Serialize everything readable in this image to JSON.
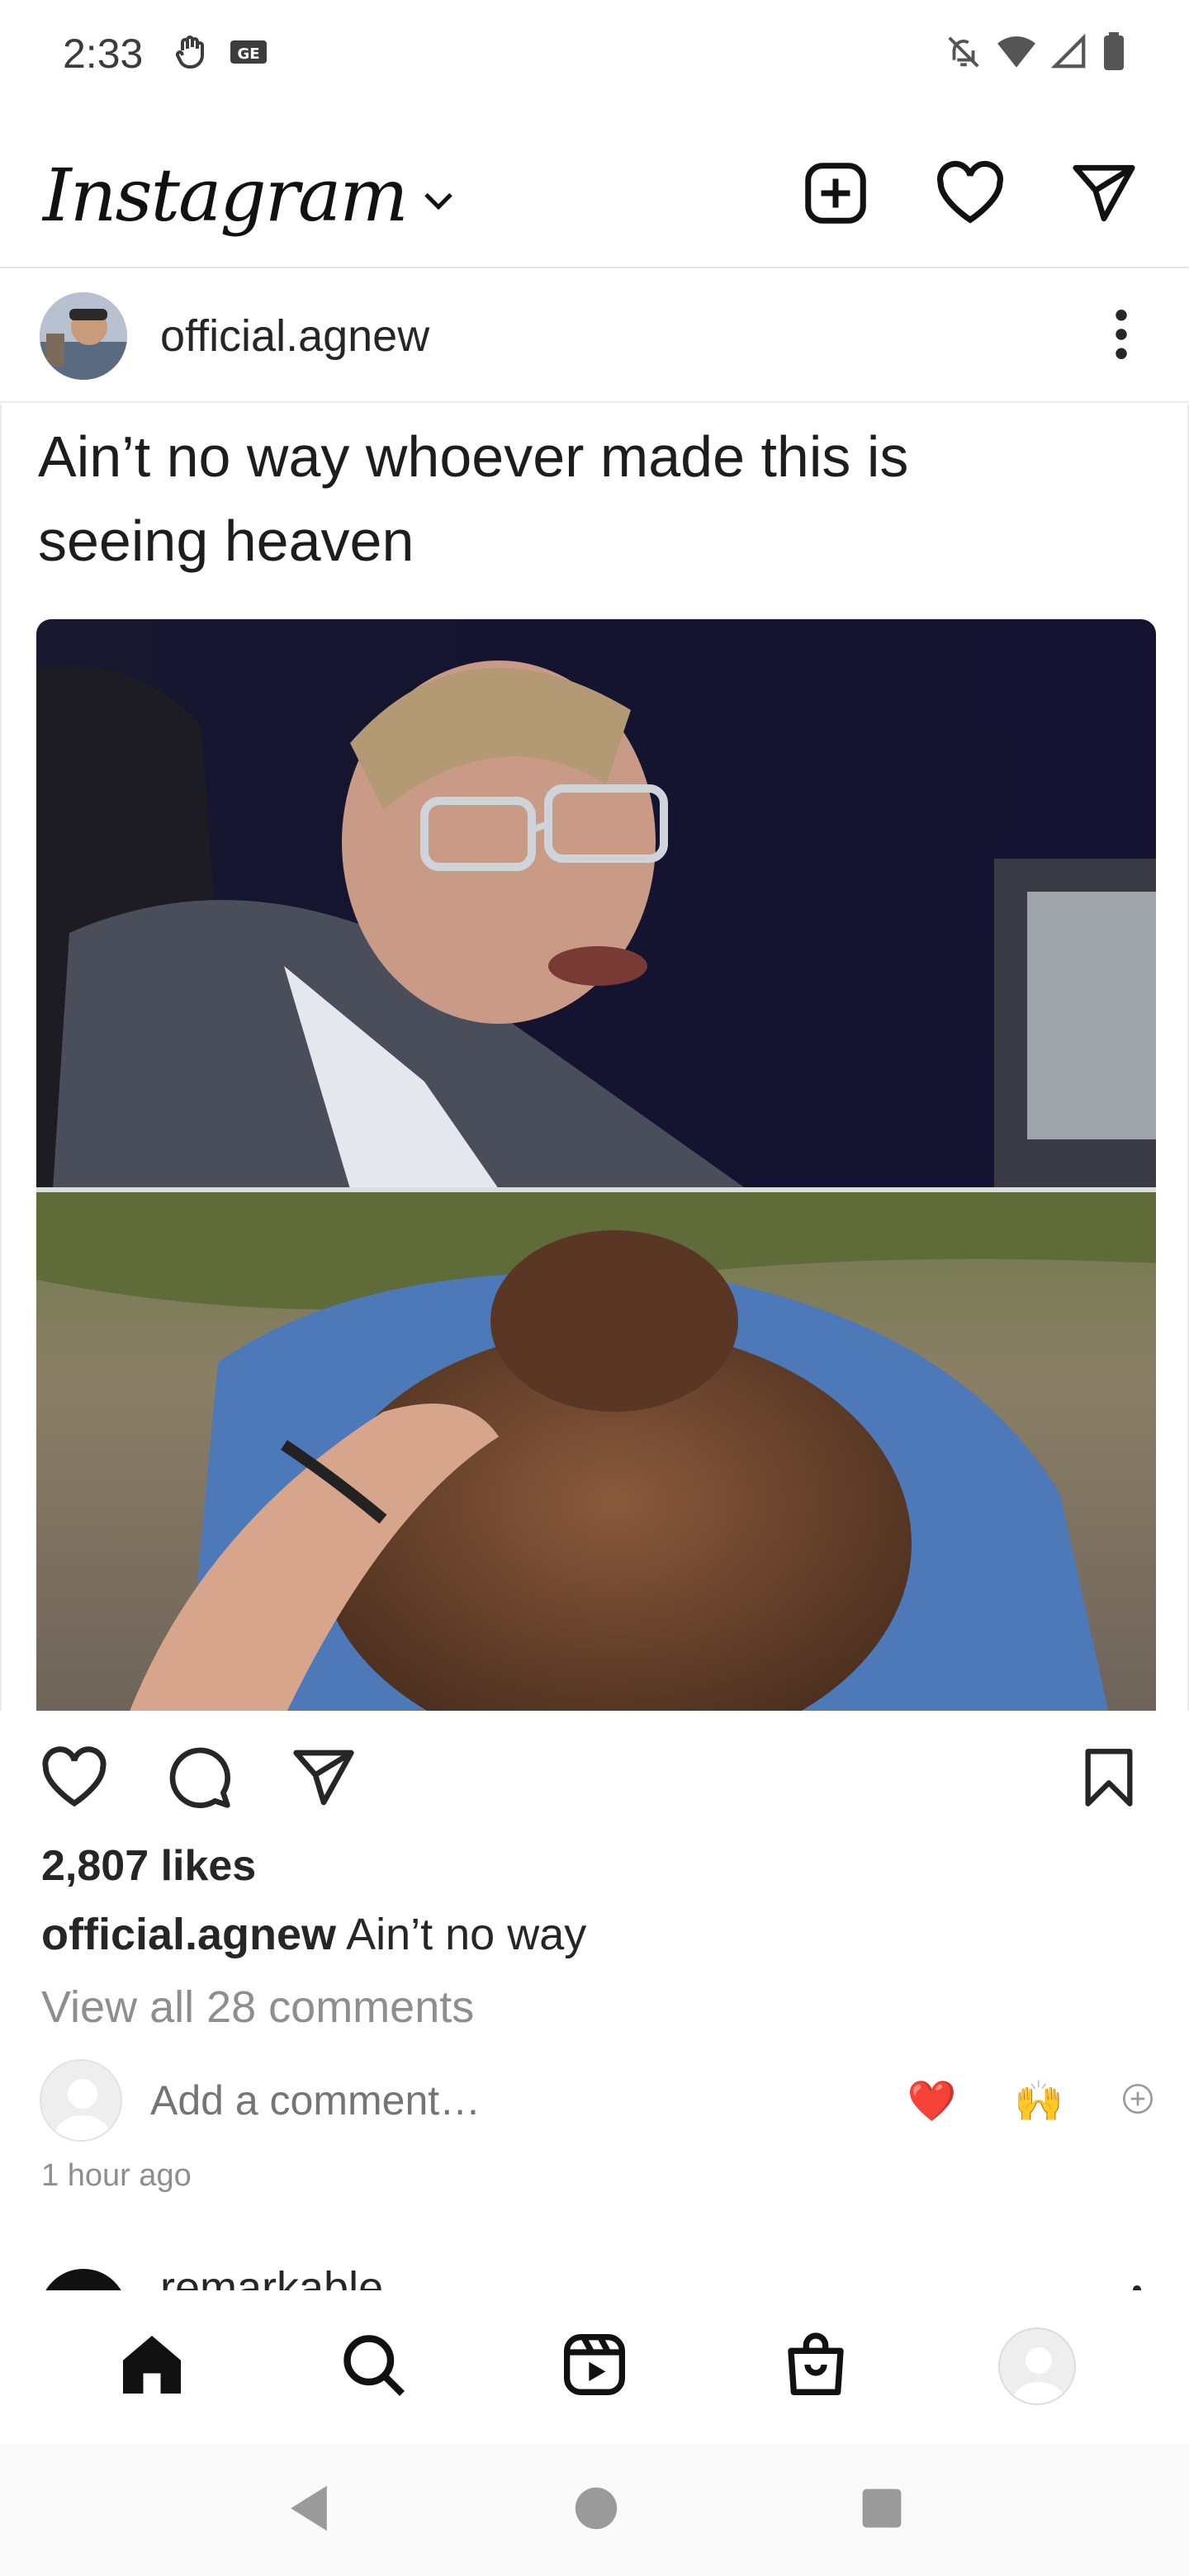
{
  "status_bar": {
    "time": "2:33"
  },
  "app_bar": {
    "logo": "Instagram"
  },
  "post": {
    "username": "official.agnew",
    "image_caption_text": "Ain’t no way whoever made this is seeing heaven",
    "likes": "2,807 likes",
    "caption_username": "official.agnew",
    "caption_text": " Ain’t no way",
    "view_comments": "View all 28 comments",
    "comment_placeholder": "Add a comment…",
    "quick_emojis": [
      "❤️",
      "🙌"
    ],
    "timestamp": "1 hour ago"
  },
  "next_post": {
    "username": "remarkable"
  },
  "colors": {
    "accent": "#262626",
    "muted": "#8e8e8e",
    "divider": "#e8e8e8"
  }
}
